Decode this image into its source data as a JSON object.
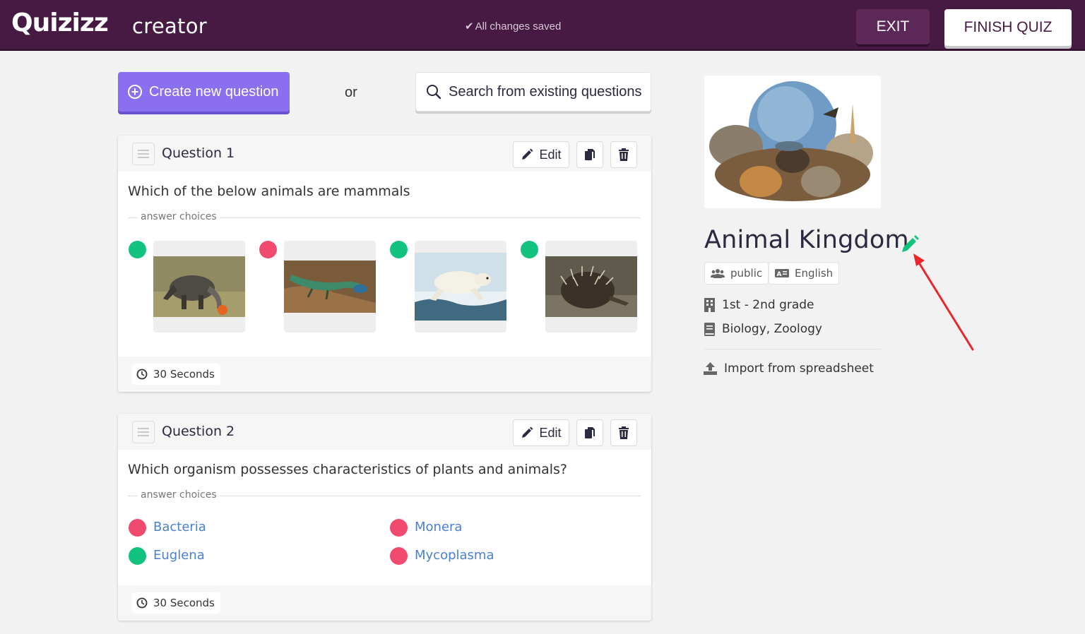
{
  "header": {
    "logo": "Quizizz",
    "logo_sub": "creator",
    "saved_status": "All changes saved",
    "exit_label": "EXIT",
    "finish_label": "FINISH QUIZ"
  },
  "actions": {
    "create_label": "Create new question",
    "or_label": "or",
    "search_label": "Search from existing questions"
  },
  "questions": [
    {
      "label": "Question 1",
      "edit_label": "Edit",
      "text": "Which of the below animals are mammals",
      "answer_choices_label": "answer choices",
      "choices": [
        {
          "image": "anteater",
          "correct": true
        },
        {
          "image": "lizard",
          "correct": false
        },
        {
          "image": "polar-bear",
          "correct": true
        },
        {
          "image": "echidna",
          "correct": true
        }
      ],
      "time": "30 Seconds"
    },
    {
      "label": "Question 2",
      "edit_label": "Edit",
      "text": "Which organism possesses characteristics of plants and animals?",
      "answer_choices_label": "answer choices",
      "choices": [
        {
          "text": "Bacteria",
          "correct": false
        },
        {
          "text": "Monera",
          "correct": false
        },
        {
          "text": "Euglena",
          "correct": true
        },
        {
          "text": "Mycoplasma",
          "correct": false
        }
      ],
      "time": "30 Seconds"
    }
  ],
  "quiz": {
    "title": "Animal Kingdom",
    "visibility": "public",
    "language": "English",
    "grade": "1st - 2nd grade",
    "subjects": "Biology, Zoology",
    "import_label": "Import from spreadsheet"
  },
  "colors": {
    "header_bg": "#461a42",
    "accent": "#8a6ff0",
    "correct": "#12c27f",
    "incorrect": "#f04a6e",
    "choice_link": "#4a80d1",
    "annotation_arrow": "#e8262b"
  }
}
